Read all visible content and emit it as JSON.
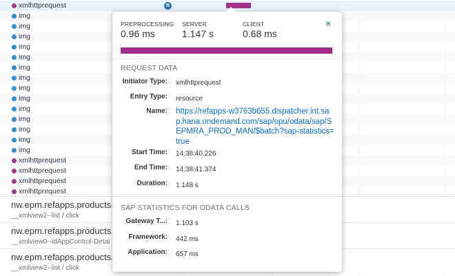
{
  "rows": [
    {
      "type": "xhr",
      "label": "xmlhttprequest"
    },
    {
      "type": "img",
      "label": "img"
    },
    {
      "type": "img",
      "label": "img"
    },
    {
      "type": "img",
      "label": "img"
    },
    {
      "type": "img",
      "label": "img"
    },
    {
      "type": "img",
      "label": "img"
    },
    {
      "type": "img",
      "label": "img"
    },
    {
      "type": "img",
      "label": "img"
    },
    {
      "type": "img",
      "label": "img"
    },
    {
      "type": "img",
      "label": "img"
    },
    {
      "type": "img",
      "label": "img"
    },
    {
      "type": "img",
      "label": "img"
    },
    {
      "type": "img",
      "label": "img"
    },
    {
      "type": "img",
      "label": "img"
    },
    {
      "type": "img",
      "label": "img"
    },
    {
      "type": "xhr",
      "label": "xmlhttprequest"
    },
    {
      "type": "xhr",
      "label": "xmlhttprequest"
    },
    {
      "type": "xhr",
      "label": "xmlhttprequest"
    },
    {
      "type": "xhr",
      "label": "xmlhttprequest"
    }
  ],
  "first_row_badge": "R",
  "interactions": [
    {
      "title": "nw.epm.refapps.products.m",
      "subtitle": "__xmlview2--list / click"
    },
    {
      "title": "nw.epm.refapps.products.m",
      "subtitle": "__xmlview0--idAppControl-Detai"
    },
    {
      "title": "nw.epm.refapps.products.m",
      "subtitle": "__xmlview2--list / click"
    }
  ],
  "popover": {
    "metrics": [
      {
        "label": "PREPROCESSING",
        "value": "0.96 ms"
      },
      {
        "label": "SERVER",
        "value": "1.147 s"
      },
      {
        "label": "CLIENT",
        "value": "0.68 ms"
      }
    ],
    "close_glyph": "×",
    "progress_fraction": 1.0,
    "progress_color": "#a3298a",
    "request_section": {
      "title": "REQUEST DATA",
      "initiator_label": "Initiator Type:",
      "initiator_value": "xmlhttprequest",
      "entry_label": "Entry Type:",
      "entry_value": "resource",
      "name_label": "Name:",
      "name_value": "https://refapps-w3763b655.dispatcher.int.sap.hana.ondemand.com/sap/opu/odata/sap/SEPMRA_PROD_MAN/$batch?sap-statistics=true",
      "start_label": "Start Time:",
      "start_value": "14:38:40.226",
      "end_label": "End Time:",
      "end_value": "14:38:41.374",
      "duration_label": "Duration:",
      "duration_value": "1.148 s"
    },
    "stats_section": {
      "title": "SAP STATISTICS FOR ODATA CALLS",
      "gateway_label": "Gateway T...:",
      "gateway_value": "1.103 s",
      "framework_label": "Framework:",
      "framework_value": "442 ms",
      "application_label": "Application:",
      "application_value": "657 ms"
    }
  },
  "colors": {
    "xhr_dot": "#a0358a",
    "img_dot": "#2d8fd5",
    "link": "#0a6ed1"
  }
}
